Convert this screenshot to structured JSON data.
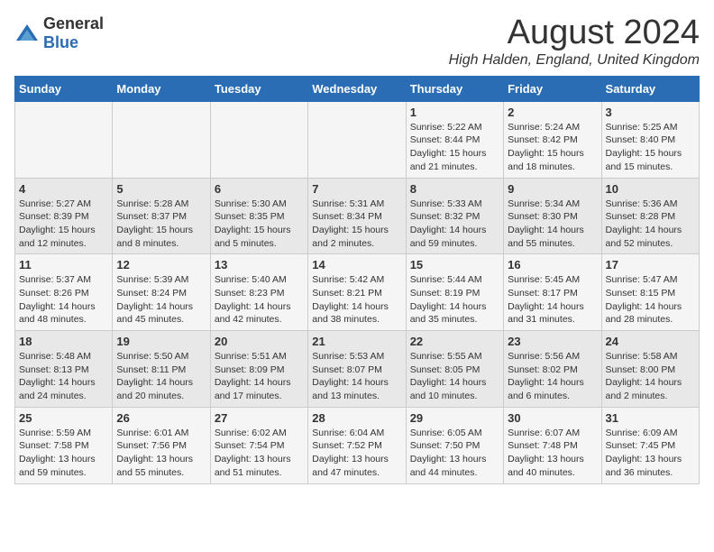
{
  "logo": {
    "general": "General",
    "blue": "Blue"
  },
  "title": "August 2024",
  "subtitle": "High Halden, England, United Kingdom",
  "weekdays": [
    "Sunday",
    "Monday",
    "Tuesday",
    "Wednesday",
    "Thursday",
    "Friday",
    "Saturday"
  ],
  "weeks": [
    [
      {
        "day": "",
        "info": ""
      },
      {
        "day": "",
        "info": ""
      },
      {
        "day": "",
        "info": ""
      },
      {
        "day": "",
        "info": ""
      },
      {
        "day": "1",
        "info": "Sunrise: 5:22 AM\nSunset: 8:44 PM\nDaylight: 15 hours\nand 21 minutes."
      },
      {
        "day": "2",
        "info": "Sunrise: 5:24 AM\nSunset: 8:42 PM\nDaylight: 15 hours\nand 18 minutes."
      },
      {
        "day": "3",
        "info": "Sunrise: 5:25 AM\nSunset: 8:40 PM\nDaylight: 15 hours\nand 15 minutes."
      }
    ],
    [
      {
        "day": "4",
        "info": "Sunrise: 5:27 AM\nSunset: 8:39 PM\nDaylight: 15 hours\nand 12 minutes."
      },
      {
        "day": "5",
        "info": "Sunrise: 5:28 AM\nSunset: 8:37 PM\nDaylight: 15 hours\nand 8 minutes."
      },
      {
        "day": "6",
        "info": "Sunrise: 5:30 AM\nSunset: 8:35 PM\nDaylight: 15 hours\nand 5 minutes."
      },
      {
        "day": "7",
        "info": "Sunrise: 5:31 AM\nSunset: 8:34 PM\nDaylight: 15 hours\nand 2 minutes."
      },
      {
        "day": "8",
        "info": "Sunrise: 5:33 AM\nSunset: 8:32 PM\nDaylight: 14 hours\nand 59 minutes."
      },
      {
        "day": "9",
        "info": "Sunrise: 5:34 AM\nSunset: 8:30 PM\nDaylight: 14 hours\nand 55 minutes."
      },
      {
        "day": "10",
        "info": "Sunrise: 5:36 AM\nSunset: 8:28 PM\nDaylight: 14 hours\nand 52 minutes."
      }
    ],
    [
      {
        "day": "11",
        "info": "Sunrise: 5:37 AM\nSunset: 8:26 PM\nDaylight: 14 hours\nand 48 minutes."
      },
      {
        "day": "12",
        "info": "Sunrise: 5:39 AM\nSunset: 8:24 PM\nDaylight: 14 hours\nand 45 minutes."
      },
      {
        "day": "13",
        "info": "Sunrise: 5:40 AM\nSunset: 8:23 PM\nDaylight: 14 hours\nand 42 minutes."
      },
      {
        "day": "14",
        "info": "Sunrise: 5:42 AM\nSunset: 8:21 PM\nDaylight: 14 hours\nand 38 minutes."
      },
      {
        "day": "15",
        "info": "Sunrise: 5:44 AM\nSunset: 8:19 PM\nDaylight: 14 hours\nand 35 minutes."
      },
      {
        "day": "16",
        "info": "Sunrise: 5:45 AM\nSunset: 8:17 PM\nDaylight: 14 hours\nand 31 minutes."
      },
      {
        "day": "17",
        "info": "Sunrise: 5:47 AM\nSunset: 8:15 PM\nDaylight: 14 hours\nand 28 minutes."
      }
    ],
    [
      {
        "day": "18",
        "info": "Sunrise: 5:48 AM\nSunset: 8:13 PM\nDaylight: 14 hours\nand 24 minutes."
      },
      {
        "day": "19",
        "info": "Sunrise: 5:50 AM\nSunset: 8:11 PM\nDaylight: 14 hours\nand 20 minutes."
      },
      {
        "day": "20",
        "info": "Sunrise: 5:51 AM\nSunset: 8:09 PM\nDaylight: 14 hours\nand 17 minutes."
      },
      {
        "day": "21",
        "info": "Sunrise: 5:53 AM\nSunset: 8:07 PM\nDaylight: 14 hours\nand 13 minutes."
      },
      {
        "day": "22",
        "info": "Sunrise: 5:55 AM\nSunset: 8:05 PM\nDaylight: 14 hours\nand 10 minutes."
      },
      {
        "day": "23",
        "info": "Sunrise: 5:56 AM\nSunset: 8:02 PM\nDaylight: 14 hours\nand 6 minutes."
      },
      {
        "day": "24",
        "info": "Sunrise: 5:58 AM\nSunset: 8:00 PM\nDaylight: 14 hours\nand 2 minutes."
      }
    ],
    [
      {
        "day": "25",
        "info": "Sunrise: 5:59 AM\nSunset: 7:58 PM\nDaylight: 13 hours\nand 59 minutes."
      },
      {
        "day": "26",
        "info": "Sunrise: 6:01 AM\nSunset: 7:56 PM\nDaylight: 13 hours\nand 55 minutes."
      },
      {
        "day": "27",
        "info": "Sunrise: 6:02 AM\nSunset: 7:54 PM\nDaylight: 13 hours\nand 51 minutes."
      },
      {
        "day": "28",
        "info": "Sunrise: 6:04 AM\nSunset: 7:52 PM\nDaylight: 13 hours\nand 47 minutes."
      },
      {
        "day": "29",
        "info": "Sunrise: 6:05 AM\nSunset: 7:50 PM\nDaylight: 13 hours\nand 44 minutes."
      },
      {
        "day": "30",
        "info": "Sunrise: 6:07 AM\nSunset: 7:48 PM\nDaylight: 13 hours\nand 40 minutes."
      },
      {
        "day": "31",
        "info": "Sunrise: 6:09 AM\nSunset: 7:45 PM\nDaylight: 13 hours\nand 36 minutes."
      }
    ]
  ]
}
